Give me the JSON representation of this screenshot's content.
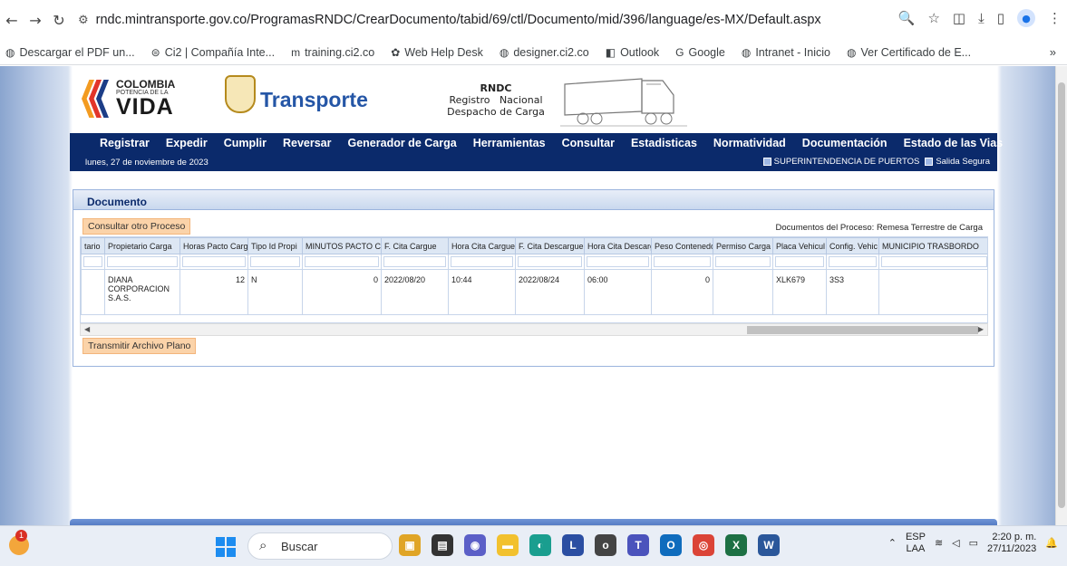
{
  "browser": {
    "url": "rndc.mintransporte.gov.co/ProgramasRNDC/CrearDocumento/tabid/69/ctl/Documento/mid/396/language/es-MX/Default.aspx",
    "bookmarks": [
      {
        "label": "Descargar el PDF un...",
        "icon": "globe-icon"
      },
      {
        "label": "Ci2 | Compañía Inte...",
        "icon": "link-icon"
      },
      {
        "label": "training.ci2.co",
        "icon": "moodle-icon"
      },
      {
        "label": "Web Help Desk",
        "icon": "helpdesk-icon"
      },
      {
        "label": "designer.ci2.co",
        "icon": "globe-icon"
      },
      {
        "label": "Outlook",
        "icon": "outlook-icon"
      },
      {
        "label": "Google",
        "icon": "google-icon"
      },
      {
        "label": "Intranet - Inicio",
        "icon": "globe-icon"
      },
      {
        "label": "Ver Certificado de E...",
        "icon": "globe-icon"
      }
    ],
    "more": "»"
  },
  "header": {
    "colombia_line1": "COLOMBIA",
    "colombia_line2": "POTENCIA DE LA",
    "colombia_line3": "VIDA",
    "ministry": "Transporte",
    "rndc_title": "RNDC",
    "rndc_line1": "Registro   Nacional",
    "rndc_line2": "Despacho de Carga"
  },
  "menu": [
    "Registrar",
    "Expedir",
    "Cumplir",
    "Reversar",
    "Generador de Carga",
    "Herramientas",
    "Consultar",
    "Estadisticas",
    "Normatividad",
    "Documentación",
    "Estado de las Vias"
  ],
  "subbar": {
    "date": "lunes, 27 de noviembre de 2023",
    "link1": "SUPERINTENDENCIA DE PUERTOS",
    "link2": "Salida Segura"
  },
  "document": {
    "title": "Documento",
    "consult_button": "Consultar otro Proceso",
    "process_label": "Documentos del Proceso: Remesa Terrestre de Carga",
    "transmit_button": "Transmitir Archivo Plano",
    "columns": [
      "tario",
      "Propietario Carga",
      "Horas Pacto Carg",
      "Tipo Id Propi",
      "MINUTOS PACTO C",
      "F. Cita Cargue",
      "Hora Cita Cargue",
      "F. Cita Descargue",
      "Hora Cita Descarg",
      "Peso Contenedo",
      "Permiso Carga",
      "Placa Vehicul",
      "Config. Vehic",
      "MUNICIPIO TRASBORDO"
    ],
    "rows": [
      [
        "",
        "DIANA CORPORACION S.A.S.",
        "12",
        "N",
        "0",
        "2022/08/20",
        "10:44",
        "2022/08/24",
        "06:00",
        "0",
        "",
        "XLK679",
        "3S3",
        ""
      ]
    ]
  },
  "taskbar": {
    "weather_badge": "1",
    "search_label": "Buscar",
    "lang_top": "ESP",
    "lang_bottom": "LAA",
    "time": "2:20 p. m.",
    "date": "27/11/2023"
  },
  "colors": {
    "navy": "#0b2a6b",
    "orange_button": "#fbd3a9",
    "link_blue": "#2556a6"
  }
}
